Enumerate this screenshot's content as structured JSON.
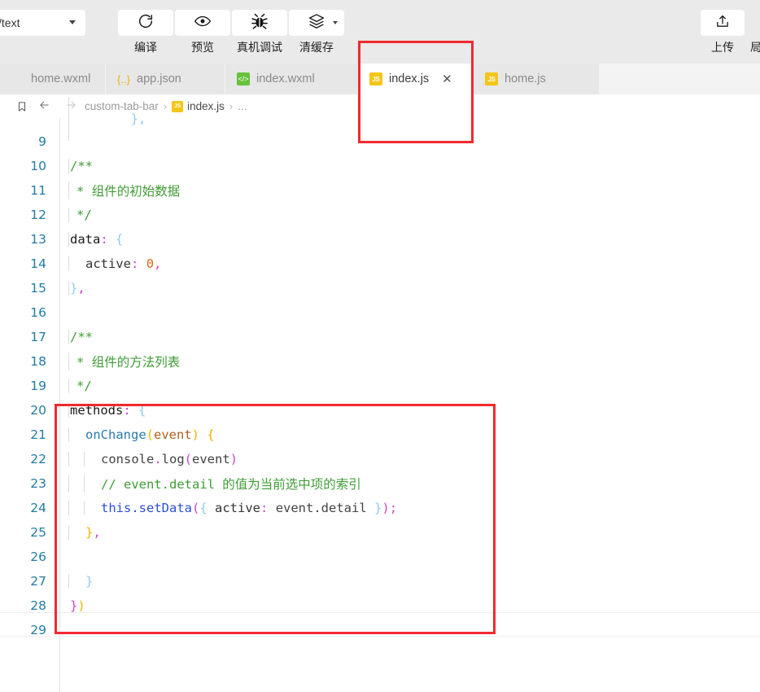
{
  "toolbar": {
    "selector_value": "/text",
    "selector_icon": "chevron-down-icon",
    "buttons": [
      {
        "icon": "refresh-icon",
        "label": "编译"
      },
      {
        "icon": "eye-icon",
        "label": "预览"
      },
      {
        "icon": "bug-icon",
        "label": "真机调试"
      },
      {
        "icon": "layers-icon",
        "label": "清缓存"
      }
    ],
    "upload": {
      "icon": "upload-icon",
      "label": "上传"
    },
    "extra_label": "局"
  },
  "tabs": [
    {
      "label": "home.wxml",
      "icon": "blank",
      "active": false,
      "closable": false
    },
    {
      "label": "app.json",
      "icon": "json",
      "icon_glyph": "{..}",
      "active": false,
      "closable": false
    },
    {
      "label": "index.wxml",
      "icon": "wxml-green",
      "icon_glyph": "</>",
      "active": false,
      "closable": false
    },
    {
      "label": "index.js",
      "icon": "js",
      "icon_glyph": "JS",
      "active": true,
      "closable": true,
      "close_glyph": "✕"
    },
    {
      "label": "home.js",
      "icon": "js",
      "icon_glyph": "JS",
      "active": false,
      "closable": false
    }
  ],
  "breadcrumb": {
    "bookmark_icon": "bookmark-icon",
    "back_icon": "arrow-left-icon",
    "forward_icon": "arrow-right-icon",
    "crumbs": [
      "custom-tab-bar",
      "index.js",
      "..."
    ],
    "file_icon_glyph": "JS",
    "separator": "›"
  },
  "editor": {
    "lines": [
      {
        "num": "",
        "fold": "",
        "partial": true
      },
      {
        "num": "9",
        "fold": ""
      },
      {
        "num": "10",
        "fold": "⌄"
      },
      {
        "num": "11",
        "fold": ""
      },
      {
        "num": "12",
        "fold": ""
      },
      {
        "num": "13",
        "fold": "⌄"
      },
      {
        "num": "14",
        "fold": ""
      },
      {
        "num": "15",
        "fold": ""
      },
      {
        "num": "16",
        "fold": ""
      },
      {
        "num": "17",
        "fold": "⌄"
      },
      {
        "num": "18",
        "fold": ""
      },
      {
        "num": "19",
        "fold": ""
      },
      {
        "num": "20",
        "fold": "⌄"
      },
      {
        "num": "21",
        "fold": "⌄"
      },
      {
        "num": "22",
        "fold": ""
      },
      {
        "num": "23",
        "fold": ""
      },
      {
        "num": "24",
        "fold": ""
      },
      {
        "num": "25",
        "fold": ""
      },
      {
        "num": "26",
        "fold": ""
      },
      {
        "num": "27",
        "fold": ""
      },
      {
        "num": "28",
        "fold": ""
      },
      {
        "num": "29",
        "fold": ""
      }
    ],
    "code": {
      "l8_partial": "},",
      "l9": "",
      "l10": "/**",
      "l11_star": "*",
      "l11_text": "组件的初始数据",
      "l12": "*/",
      "l13_key": "data",
      "l13_colon": ":",
      "l13_brace": "{",
      "l14_key": "active",
      "l14_colon": ":",
      "l14_val": "0",
      "l14_comma": ",",
      "l15_brace": "}",
      "l15_comma": ",",
      "l16": "",
      "l17": "/**",
      "l18_star": "*",
      "l18_text": "组件的方法列表",
      "l19": "*/",
      "l20_key": "methods",
      "l20_colon": ":",
      "l20_brace": "{",
      "l21_fn": "onChange",
      "l21_lparen": "(",
      "l21_param": "event",
      "l21_rparen": ")",
      "l21_brace": "{",
      "l22_obj": "console",
      "l22_dot": ".",
      "l22_fn": "log",
      "l22_lparen": "(",
      "l22_arg": "event",
      "l22_rparen": ")",
      "l23_comment": "// event.detail 的值为当前选中项的索引",
      "l24_this": "this",
      "l24_dot": ".",
      "l24_fn": "setData",
      "l24_lparen": "(",
      "l24_lbrace": "{",
      "l24_key": " active",
      "l24_colon": ":",
      "l24_val": " event.detail ",
      "l24_rbrace": "}",
      "l24_rparen": ")",
      "l24_semi": ";",
      "l25_brace": "}",
      "l25_comma": ",",
      "l26": "",
      "l27_brace": "}",
      "l28_brace": "}",
      "l28_paren": ")",
      "l29": ""
    }
  },
  "annotations": {
    "highlight_color": "#f2292f",
    "boxes": [
      {
        "name": "index-js-tab-highlight"
      },
      {
        "name": "methods-block-highlight"
      }
    ]
  }
}
